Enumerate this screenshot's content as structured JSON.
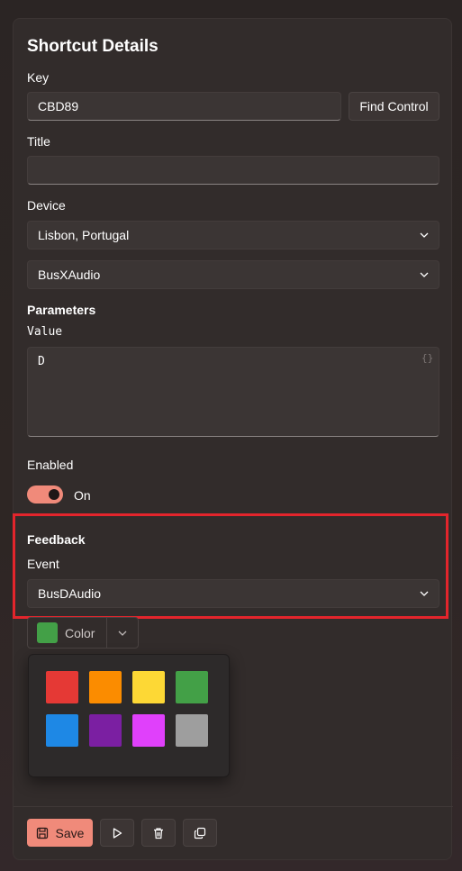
{
  "header": {
    "title": "Shortcut Details"
  },
  "key": {
    "label": "Key",
    "value": "CBD89",
    "find_button": "Find Control"
  },
  "title_field": {
    "label": "Title",
    "value": ""
  },
  "device": {
    "label": "Device",
    "selected": "Lisbon, Portugal",
    "secondary_selected": "BusXAudio"
  },
  "parameters": {
    "heading": "Parameters",
    "value_label": "Value",
    "value_text": "D",
    "json_hint": "{}"
  },
  "enabled": {
    "label": "Enabled",
    "state_text": "On",
    "on": true
  },
  "feedback": {
    "heading": "Feedback",
    "event_label": "Event",
    "event_selected": "BusDAudio"
  },
  "color_picker": {
    "button_label": "Color",
    "selected_color": "#43a047",
    "swatches": [
      "#e53935",
      "#fb8c00",
      "#fdd835",
      "#43a047",
      "#1e88e5",
      "#7b1fa2",
      "#e040fb",
      "#9e9e9e"
    ]
  },
  "footer": {
    "save_label": "Save"
  },
  "colors": {
    "accent": "#f08a7a",
    "highlight": "#e3252c"
  }
}
